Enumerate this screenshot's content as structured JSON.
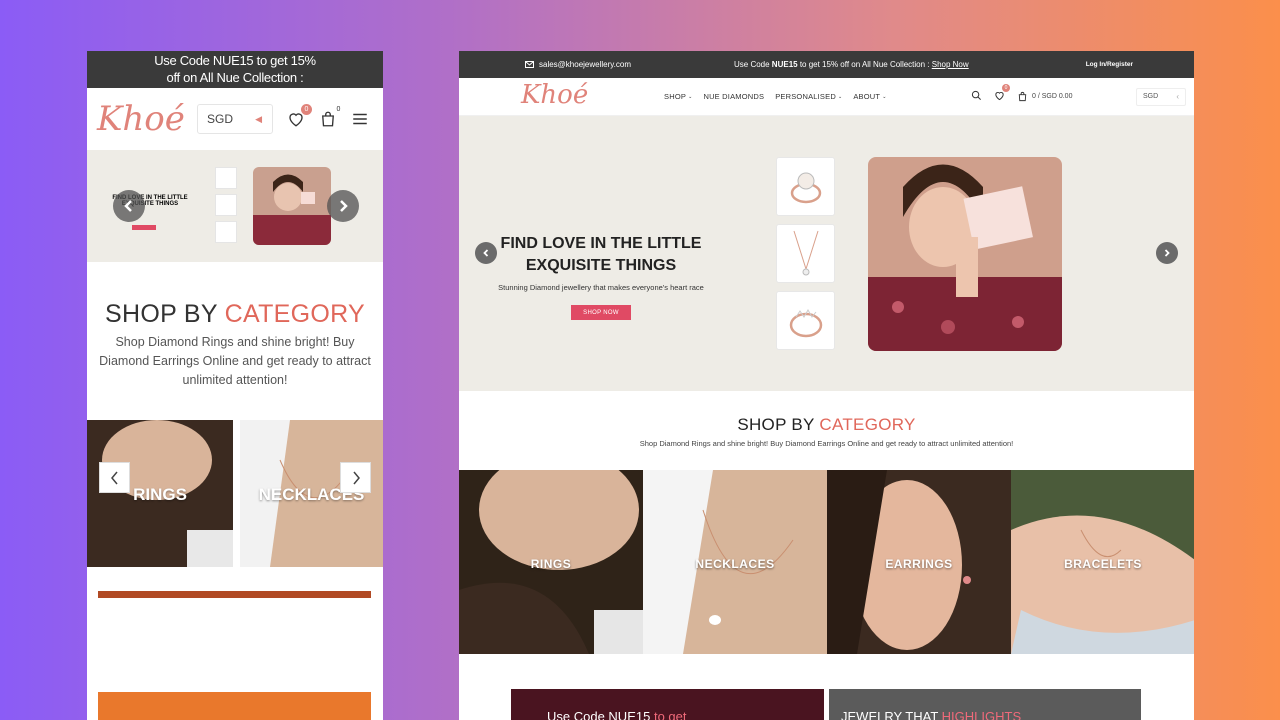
{
  "mobile": {
    "promo_line1": "Use Code NUE15 to get 15%",
    "promo_line2": "off on All Nue Collection :",
    "logo": "Khoé",
    "currency": "SGD",
    "wishlist_count": "0",
    "cart_count": "0",
    "hero_title": "FIND LOVE IN THE LITTLE EXQUISITE THINGS",
    "category_title_a": "SHOP BY ",
    "category_title_b": "CATEGORY",
    "category_desc": "Shop Diamond Rings and shine bright! Buy Diamond Earrings Online and get ready to attract unlimited attention!",
    "categories": [
      "RINGS",
      "NECKLACES"
    ]
  },
  "desktop": {
    "email": "sales@khoejewellery.com",
    "promo_a": "Use Code ",
    "promo_code": "NUE15",
    "promo_b": " to get 15% off on All Nue Collection : ",
    "promo_link": "Shop Now",
    "login": "Log In/Register",
    "logo": "Khoé",
    "menu": [
      "SHOP",
      "NUE DIAMONDS",
      "PERSONALISED",
      "ABOUT"
    ],
    "wishlist_count": "0",
    "cart_text": "0 / SGD 0.00",
    "currency": "SGD",
    "hero_title_line1": "FIND LOVE IN THE LITTLE",
    "hero_title_line2": "EXQUISITE THINGS",
    "hero_sub": "Stunning Diamond jewellery that makes everyone's heart race",
    "hero_button": "SHOP NOW",
    "category_title_a": "SHOP BY ",
    "category_title_b": "CATEGORY",
    "category_desc": "Shop Diamond Rings and shine bright! Buy Diamond Earrings Online and get ready to attract unlimited attention!",
    "categories": [
      "RINGS",
      "NECKLACES",
      "EARRINGS",
      "BRACELETS"
    ],
    "banner1_a": "Use Code NUE15 ",
    "banner1_b": "to get",
    "banner2_a": "JEWELRY THAT ",
    "banner2_b": "HIGHLIGHTS"
  },
  "colors": {
    "accent": "#e0675a",
    "logo": "#e0837a",
    "button": "#e04a64",
    "topbar": "#3a3a3a",
    "hero_bg": "#eeece6"
  }
}
